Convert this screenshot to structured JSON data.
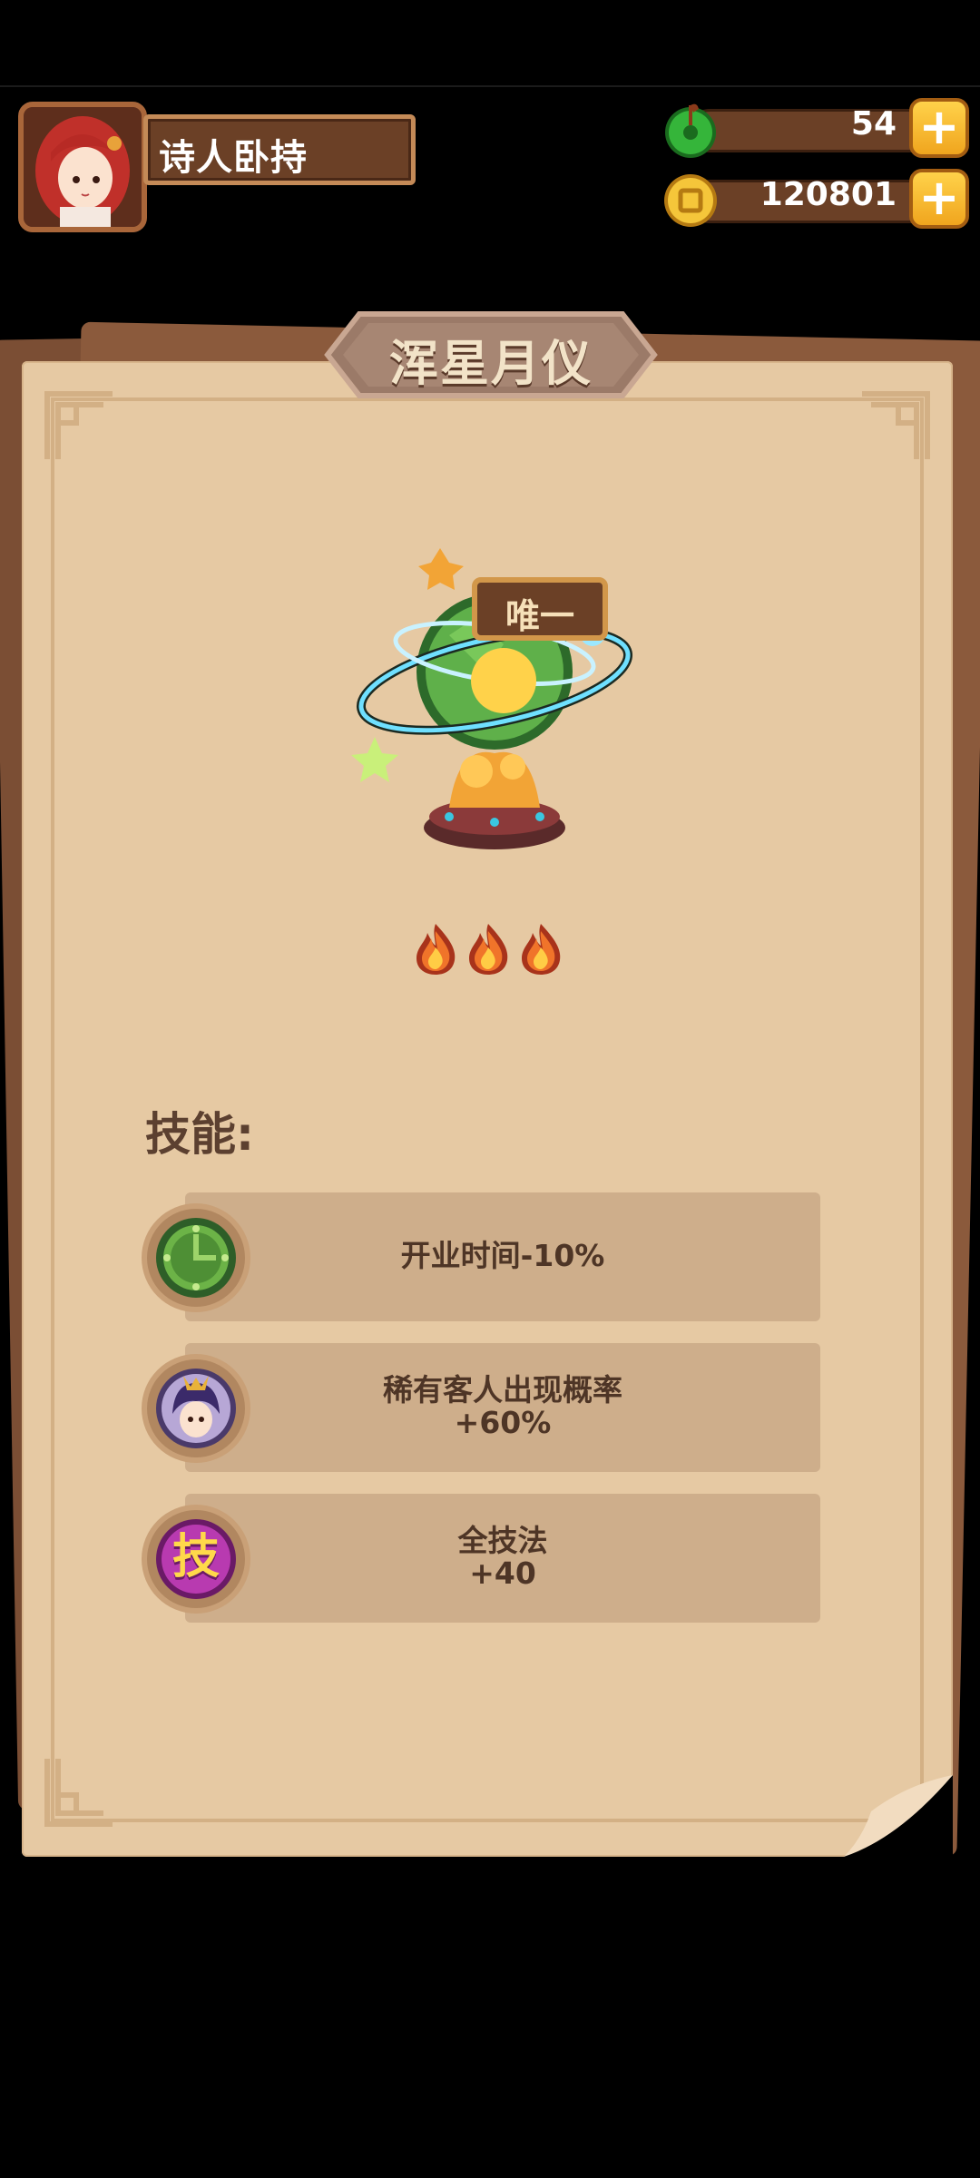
{
  "player": {
    "name": "诗人卧持",
    "avatar_icon": "red-hair-girl-avatar"
  },
  "currencies": [
    {
      "name": "jade",
      "icon": "green-jade-icon",
      "value": "54",
      "add_label": "+"
    },
    {
      "name": "coins",
      "icon": "gold-coin-icon",
      "value": "120801",
      "add_label": "+"
    }
  ],
  "item": {
    "title": "浑星月仪",
    "tag": "唯一",
    "rating_flames": 3,
    "image_icon": "armillary-sphere-icon"
  },
  "skills": {
    "label": "技能:",
    "items": [
      {
        "icon": "clock-icon",
        "line1": "开业时间-10%",
        "line2": ""
      },
      {
        "icon": "customer-portrait-icon",
        "line1": "稀有客人出现概率",
        "line2": "+60%"
      },
      {
        "icon": "skill-badge-icon",
        "icon_char": "技",
        "line1": "全技法",
        "line2": "+40"
      }
    ]
  },
  "colors": {
    "card_bg": "#e6c9a3",
    "skill_bg": "#ceae8b",
    "text_dark": "#4e3526"
  }
}
